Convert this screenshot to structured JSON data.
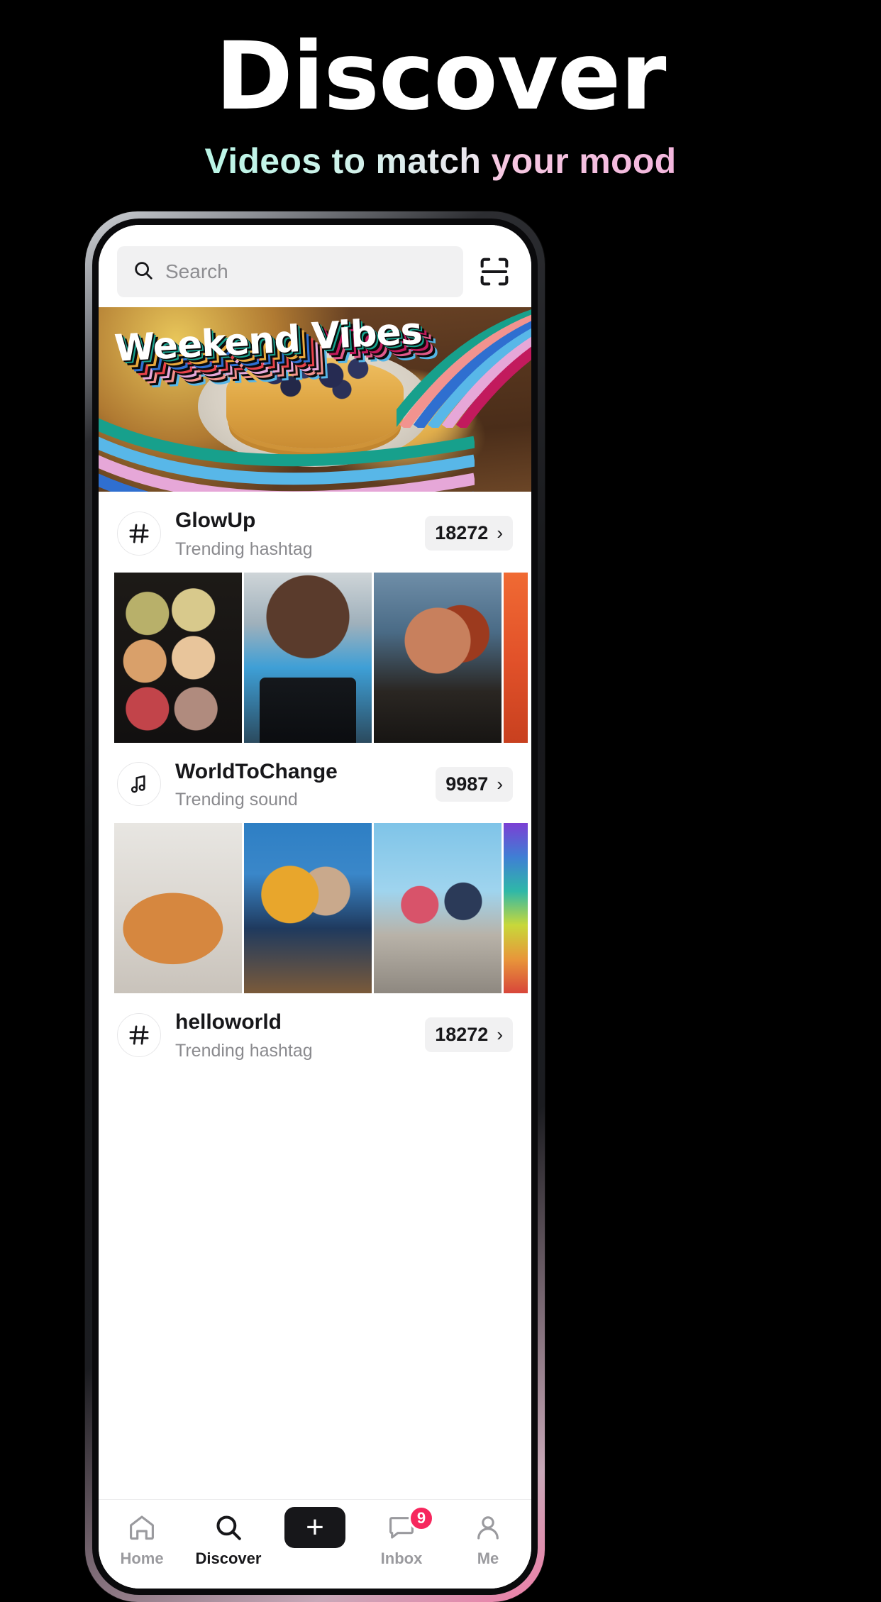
{
  "promo": {
    "title": "Discover",
    "subtitle_part1": "Videos to match ",
    "subtitle_part2": "your mood",
    "colors": {
      "background": "#000000",
      "title": "#ffffff",
      "subtitle_mint": "#b9f5e6",
      "subtitle_pink": "#f3b6dd",
      "accent_cyan": "#27e5ee",
      "accent_pink": "#f6275d"
    }
  },
  "screen": {
    "search": {
      "placeholder": "Search",
      "icon": "search-icon",
      "scan_icon": "scan-qr-icon"
    },
    "banner": {
      "word1": "Weekend",
      "word2": "Vibes"
    },
    "trends": [
      {
        "icon": "hashtag-icon",
        "title": "GlowUp",
        "subtitle": "Trending hashtag",
        "count": "18272",
        "chevron": "›",
        "thumbs": [
          "t-palette",
          "t-makeup",
          "t-redhair",
          "t-orange"
        ]
      },
      {
        "icon": "music-note-icon",
        "title": "WorldToChange",
        "subtitle": "Trending sound",
        "count": "9987",
        "chevron": "›",
        "thumbs": [
          "t-dog",
          "t-protest",
          "t-basket",
          "t-rainbowbar"
        ]
      },
      {
        "icon": "hashtag-icon",
        "title": "helloworld",
        "subtitle": "Trending hashtag",
        "count": "18272",
        "chevron": "›",
        "thumbs": []
      }
    ],
    "bottom_nav": [
      {
        "label": "Home",
        "icon": "home-icon",
        "active": false,
        "badge": null
      },
      {
        "label": "Discover",
        "icon": "search-icon",
        "active": true,
        "badge": null
      },
      {
        "label": "",
        "icon": "plus-icon",
        "active": false,
        "badge": null
      },
      {
        "label": "Inbox",
        "icon": "inbox-icon",
        "active": false,
        "badge": "9"
      },
      {
        "label": "Me",
        "icon": "person-icon",
        "active": false,
        "badge": null
      }
    ]
  }
}
